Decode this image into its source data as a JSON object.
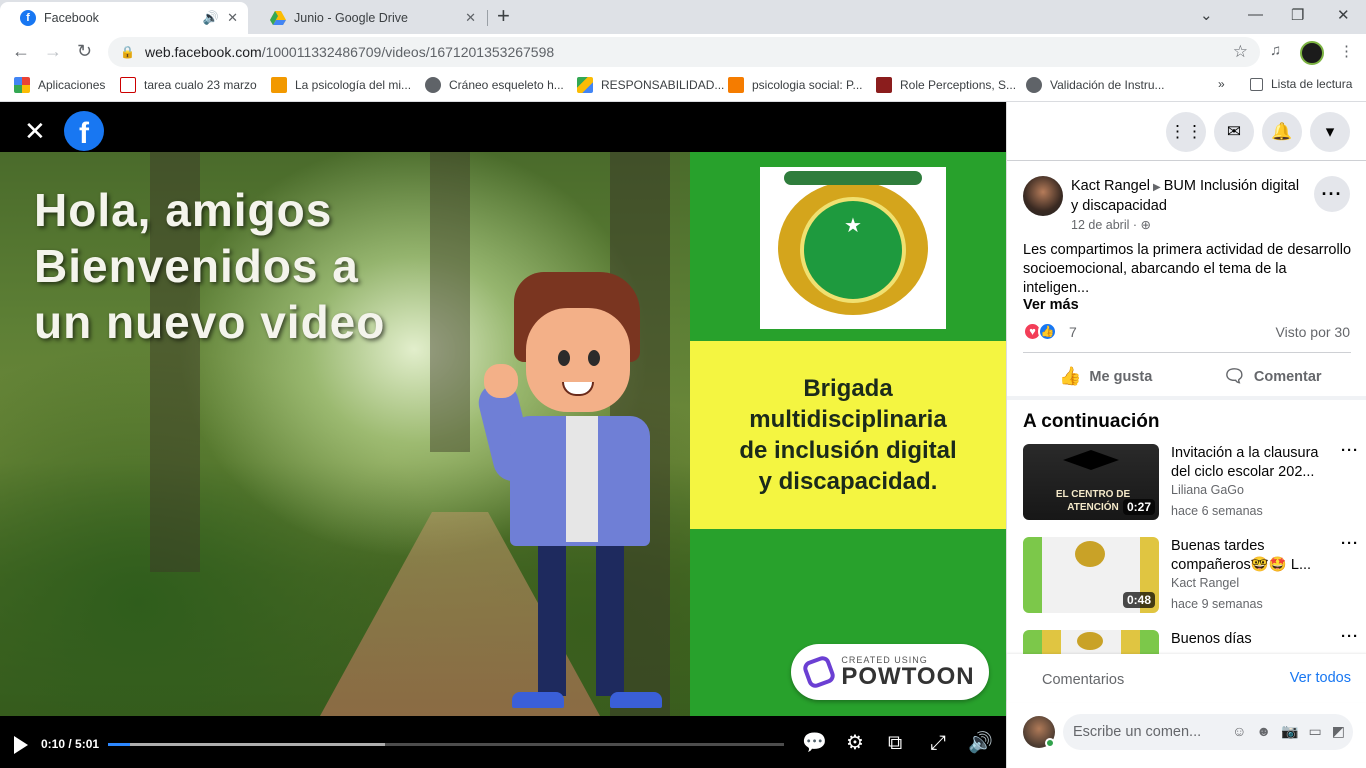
{
  "browser": {
    "tabs": [
      {
        "title": "Facebook",
        "active": true
      },
      {
        "title": "Junio - Google Drive",
        "active": false
      }
    ],
    "url_host": "web.facebook.com",
    "url_path": "/100011332486709/videos/1671201353267598",
    "bookmarks": [
      "Aplicaciones",
      "tarea cualo 23 marzo",
      "La psicología del mi...",
      "Cráneo esqueleto h...",
      "RESPONSABILIDAD...",
      "psicologia social: P...",
      "Role Perceptions, S...",
      "Validación de Instru..."
    ],
    "reading_list": "Lista de lectura",
    "more_bookmarks": "»"
  },
  "video": {
    "greeting_lines": [
      "Hola, amigos",
      "Bienvenidos a",
      "un nuevo video"
    ],
    "banner_lines": [
      "Brigada",
      "multidisciplinaria",
      "de inclusión digital",
      "y discapacidad."
    ],
    "powtoon_small": "CREATED USING",
    "powtoon_big": "POWTOON",
    "time": "0:10 / 5:01",
    "progress_fraction": 0.033,
    "buffer_fraction": 0.41
  },
  "post": {
    "author": "Kact Rangel",
    "group": "BUM Inclusión digital y discapacidad",
    "date": "12 de abril ·",
    "text": "Les compartimos la primera actividad de desarrollo socioemocional, abarcando el tema de la inteligen...",
    "see_more": "Ver más",
    "reaction_count": "7",
    "views": "Visto por 30",
    "like_label": "Me gusta",
    "comment_label": "Comentar"
  },
  "up_next": {
    "title": "A continuación",
    "items": [
      {
        "title": "Invitación a la clausura del ciclo escolar 202...",
        "author": "Liliana GaGo",
        "time": "hace 6 semanas",
        "duration": "0:27"
      },
      {
        "title": "Buenas tardes compañeros🤓🤩 L...",
        "author": "Kact Rangel",
        "time": "hace 9 semanas",
        "duration": "0:48"
      },
      {
        "title": "Buenos días",
        "author": "",
        "time": "",
        "duration": ""
      }
    ]
  },
  "thumb1_text": "EL CENTRO DE ATENCIÓN",
  "comments": {
    "label": "Comentarios",
    "see_all": "Ver todos",
    "placeholder": "Escribe un comen..."
  },
  "colors": {
    "fb_blue": "#1877f2",
    "video_green": "#28a12c",
    "banner_yellow": "#f4f541"
  }
}
